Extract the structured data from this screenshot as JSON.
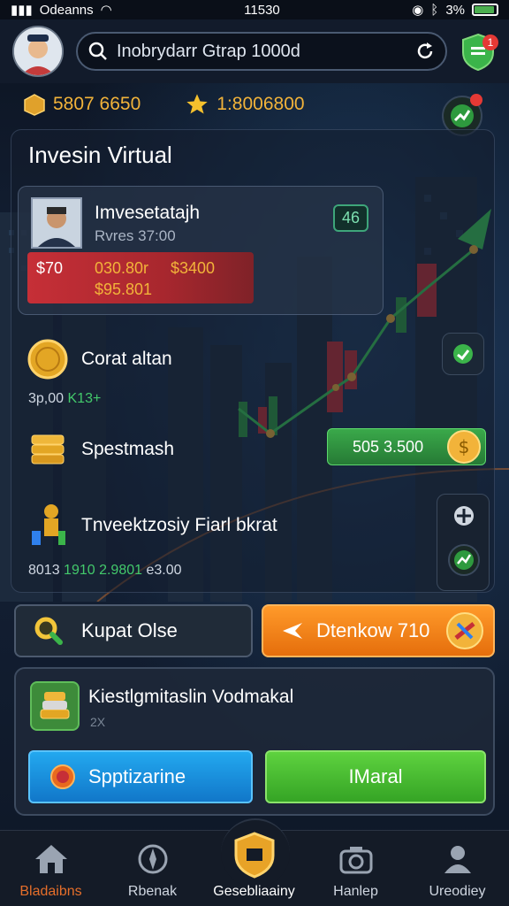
{
  "status_bar": {
    "carrier": "Odeanns",
    "time": "11530",
    "battery": "3%",
    "battery_level": 0.9
  },
  "header": {
    "search_text": "Inobrydarr Gtrap 1000d",
    "notification_count": "1"
  },
  "currency": {
    "gold": "5807 6650",
    "stars": "1:8006800"
  },
  "panel": {
    "title": "Invesin Virtual",
    "profile": {
      "name": "Imvesetatajh",
      "sub": "Rvres 37:00",
      "badge": "46",
      "strip_a": "$70",
      "strip_b": "030.80r",
      "strip_c": "$3400",
      "strip_d": "$95.801"
    },
    "rows": [
      {
        "label": "Corat altan",
        "sub_a": "3p,00",
        "sub_b": "K13+"
      },
      {
        "label": "Spestmash"
      },
      {
        "label": "Tnveektzosiy Fiarl bkrat",
        "sub_a": "8013",
        "sub_b": "1910 2.9801",
        "sub_c": "e3.00"
      }
    ],
    "green_pill_value": "505 3.500"
  },
  "actions": {
    "quick_label": "Kupat Olse",
    "orange_label": "Dtenkow 710"
  },
  "bottom_card": {
    "title": "Kiestlgmitaslin Vodmakal",
    "sub": "2X",
    "blue_button": "Spptizarine",
    "green_button": "IMaral"
  },
  "nav": [
    {
      "label": "Bladaibns",
      "icon": "home-icon"
    },
    {
      "label": "Rbenak",
      "icon": "compass-icon"
    },
    {
      "label": "Gesebliaainy",
      "icon": "shield-icon"
    },
    {
      "label": "Hanlep",
      "icon": "camera-icon"
    },
    {
      "label": "Ureodiey",
      "icon": "user-icon"
    }
  ],
  "colors": {
    "accent_orange": "#e56e0c",
    "accent_green": "#35a425",
    "accent_blue": "#1177c9",
    "gold": "#f2b33a"
  }
}
